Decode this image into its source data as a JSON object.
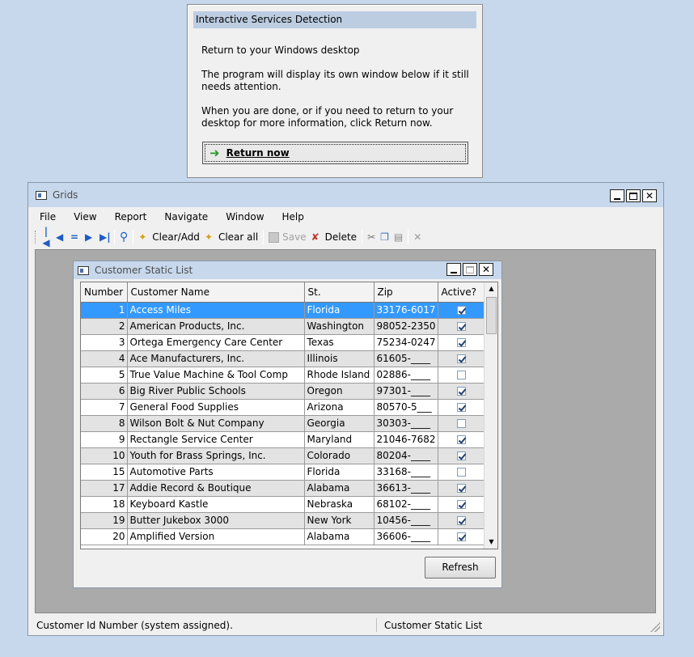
{
  "isd": {
    "title": "Interactive Services Detection",
    "line1": "Return to your Windows desktop",
    "line2": "The program will display its own window below if it still needs attention.",
    "line3": "When you are done, or if you need to return to your desktop for more information, click Return now.",
    "button": "Return now",
    "button_icon": "green-arrow-icon"
  },
  "grids": {
    "title": "Grids",
    "menu": [
      "File",
      "View",
      "Report",
      "Navigate",
      "Window",
      "Help"
    ],
    "toolbar": {
      "clear_add": "Clear/Add",
      "clear_all": "Clear all",
      "save": "Save",
      "delete": "Delete"
    },
    "status_left": "Customer Id Number (system assigned).",
    "status_right": "Customer Static List"
  },
  "csl": {
    "title": "Customer Static List",
    "columns": [
      "Number",
      "Customer Name",
      "St.",
      "Zip",
      "Active?"
    ],
    "rows": [
      {
        "number": "1",
        "name": "Access Miles",
        "state": "Florida",
        "zip": "33176-6017",
        "active": true,
        "selected": true
      },
      {
        "number": "2",
        "name": "American Products, Inc.",
        "state": "Washington",
        "zip": "98052-2350",
        "active": true
      },
      {
        "number": "3",
        "name": "Ortega Emergency Care Center",
        "state": "Texas",
        "zip": "75234-0247",
        "active": true
      },
      {
        "number": "4",
        "name": "Ace Manufacturers, Inc.",
        "state": "Illinois",
        "zip": "61605-____",
        "active": true
      },
      {
        "number": "5",
        "name": "True Value Machine & Tool Comp",
        "state": "Rhode Island",
        "zip": "02886-____",
        "active": false
      },
      {
        "number": "6",
        "name": "Big River Public Schools",
        "state": "Oregon",
        "zip": "97301-____",
        "active": true
      },
      {
        "number": "7",
        "name": "General Food Supplies",
        "state": "Arizona",
        "zip": "80570-5___",
        "active": true
      },
      {
        "number": "8",
        "name": "Wilson Bolt & Nut Company",
        "state": "Georgia",
        "zip": "30303-____",
        "active": false
      },
      {
        "number": "9",
        "name": "Rectangle Service Center",
        "state": "Maryland",
        "zip": "21046-7682",
        "active": true
      },
      {
        "number": "10",
        "name": "Youth for Brass Springs, Inc.",
        "state": "Colorado",
        "zip": "80204-____",
        "active": true
      },
      {
        "number": "15",
        "name": "Automotive Parts",
        "state": "Florida",
        "zip": "33168-____",
        "active": false
      },
      {
        "number": "17",
        "name": "Addie Record & Boutique",
        "state": "Alabama",
        "zip": "36613-____",
        "active": true
      },
      {
        "number": "18",
        "name": "Keyboard Kastle",
        "state": "Nebraska",
        "zip": "68102-____",
        "active": true
      },
      {
        "number": "19",
        "name": "Butter Jukebox 3000",
        "state": "New York",
        "zip": "10456-____",
        "active": true
      },
      {
        "number": "20",
        "name": "Amplified Version",
        "state": "Alabama",
        "zip": "36606-____",
        "active": true
      }
    ],
    "refresh": "Refresh"
  },
  "colors": {
    "desktop": "#c7d8ec",
    "selection": "#3399ff",
    "mdi_background": "#aaaaaa"
  }
}
